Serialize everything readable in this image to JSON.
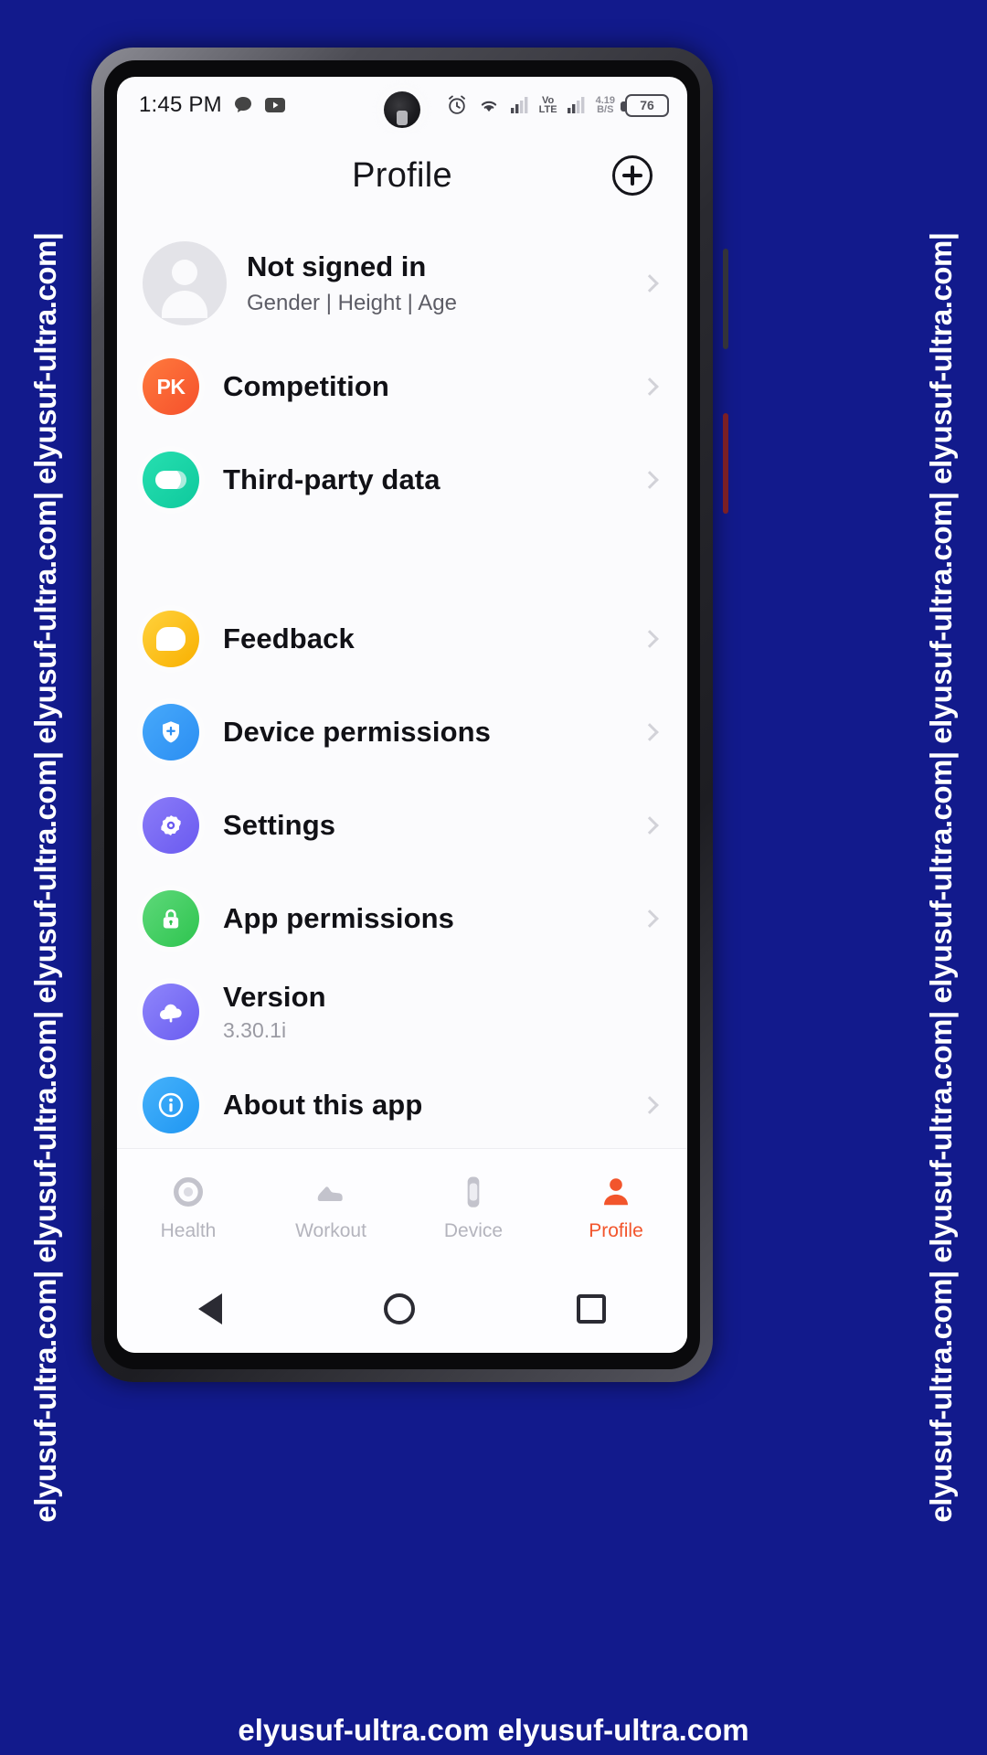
{
  "watermark": {
    "side_text": "elyusuf-ultra.com| elyusuf-ultra.com| elyusuf-ultra.com| elyusuf-ultra.com| elyusuf-ultra.com|",
    "bottom_text": "elyusuf-ultra.com elyusuf-ultra.com"
  },
  "statusbar": {
    "time": "1:45 PM",
    "left_icons": [
      "chat-bubble-icon",
      "youtube-icon"
    ],
    "right_icons": [
      "alarm-icon",
      "wifi-icon",
      "signal-bars-icon",
      "signal-bars-icon"
    ],
    "volte_line1": "Vo",
    "volte_line2": "LTE",
    "netspeed_line1": "4.19",
    "netspeed_line2": "B/S",
    "battery_level": "76"
  },
  "appbar": {
    "title": "Profile",
    "add_label": "+"
  },
  "profile": {
    "name": "Not signed in",
    "subtitle": "Gender | Height | Age"
  },
  "menu": [
    {
      "icon": "pk-icon",
      "icon_text": "PK",
      "label": "Competition",
      "sub": ""
    },
    {
      "icon": "capsule-icon",
      "icon_text": "",
      "label": "Third-party data",
      "sub": ""
    },
    {
      "icon": "feedback-icon",
      "icon_text": "",
      "label": "Feedback",
      "sub": ""
    },
    {
      "icon": "shield-icon",
      "icon_text": "",
      "label": "Device permissions",
      "sub": ""
    },
    {
      "icon": "gear-icon",
      "icon_text": "",
      "label": "Settings",
      "sub": ""
    },
    {
      "icon": "lock-icon",
      "icon_text": "",
      "label": "App permissions",
      "sub": ""
    },
    {
      "icon": "cloud-upload-icon",
      "icon_text": "",
      "label": "Version",
      "sub": "3.30.1i"
    },
    {
      "icon": "info-icon",
      "icon_text": "",
      "label": "About this app",
      "sub": ""
    }
  ],
  "bottomnav": {
    "items": [
      {
        "label": "Health",
        "icon": "health-ring-icon",
        "active": false
      },
      {
        "label": "Workout",
        "icon": "shoe-icon",
        "active": false
      },
      {
        "label": "Device",
        "icon": "watch-icon",
        "active": false
      },
      {
        "label": "Profile",
        "icon": "person-icon",
        "active": true
      }
    ]
  },
  "sysnav": {
    "back": "back-triangle-icon",
    "home": "home-circle-icon",
    "recents": "recents-square-icon"
  },
  "colors": {
    "accent": "#f2552c",
    "frame": "#121a8c",
    "screen_bg": "#fbfbfd"
  }
}
